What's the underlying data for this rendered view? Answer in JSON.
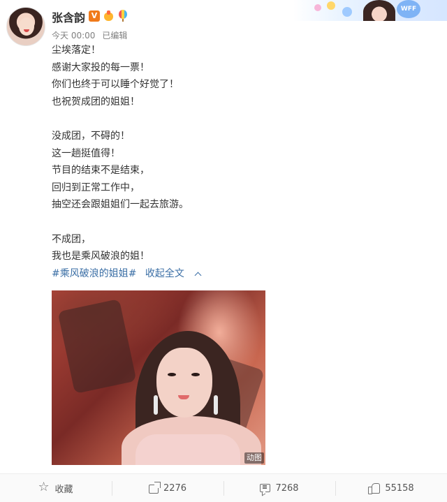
{
  "post": {
    "author": "张含韵",
    "time": "今天 00:00",
    "edited": "已编辑",
    "paragraphs": [
      [
        "尘埃落定！",
        "感谢大家投的每一票！",
        "你们也终于可以睡个好觉了！",
        "也祝贺成团的姐姐！"
      ],
      [
        "没成团，不碍的！",
        "这一趟挺值得！",
        "节目的结束不是结束，",
        "回归到正常工作中，",
        "抽空还会跟姐姐们一起去旅游。"
      ],
      [
        "不成团，",
        "我也是乘风破浪的姐！"
      ]
    ],
    "hashtag": "#乘风破浪的姐姐#",
    "collapse_label": "收起全文",
    "media_label": "动图"
  },
  "banner": {
    "text": "WFF"
  },
  "actions": {
    "favorite_label": "收藏",
    "reposts": "2276",
    "comments": "7268",
    "likes": "55158"
  },
  "icons": [
    "verified-v-icon",
    "hand-badge-icon",
    "balloon-badge-icon",
    "star-icon",
    "share-icon",
    "comment-icon",
    "like-icon",
    "chevron-up-icon"
  ],
  "colors": {
    "link": "#3a6ea5",
    "verified": "#f07a1a",
    "text": "#333333",
    "meta": "#808080"
  }
}
